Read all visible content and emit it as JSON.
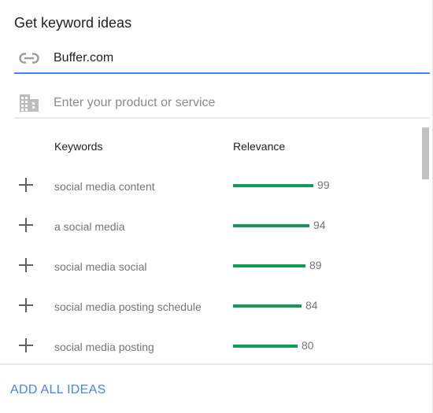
{
  "panel": {
    "title": "Get keyword ideas"
  },
  "url_field": {
    "icon": "link-icon",
    "value": "Buffer.com"
  },
  "product_field": {
    "icon": "domain-building-icon",
    "placeholder": "Enter your product or service",
    "value": ""
  },
  "table": {
    "headers": {
      "keywords": "Keywords",
      "relevance": "Relevance"
    },
    "rows": [
      {
        "keyword": "social media content",
        "relevance": 99
      },
      {
        "keyword": "a social media",
        "relevance": 94
      },
      {
        "keyword": "social media social",
        "relevance": 89
      },
      {
        "keyword": "social media posting schedule",
        "relevance": 84
      },
      {
        "keyword": "social media posting",
        "relevance": 80
      }
    ],
    "add_icon": "plus-icon"
  },
  "footer": {
    "add_all_label": "ADD ALL IDEAS"
  },
  "colors": {
    "accent": "#4285f4",
    "relevance_bar": "#0f9d58",
    "divider": "#e8e8e8"
  }
}
